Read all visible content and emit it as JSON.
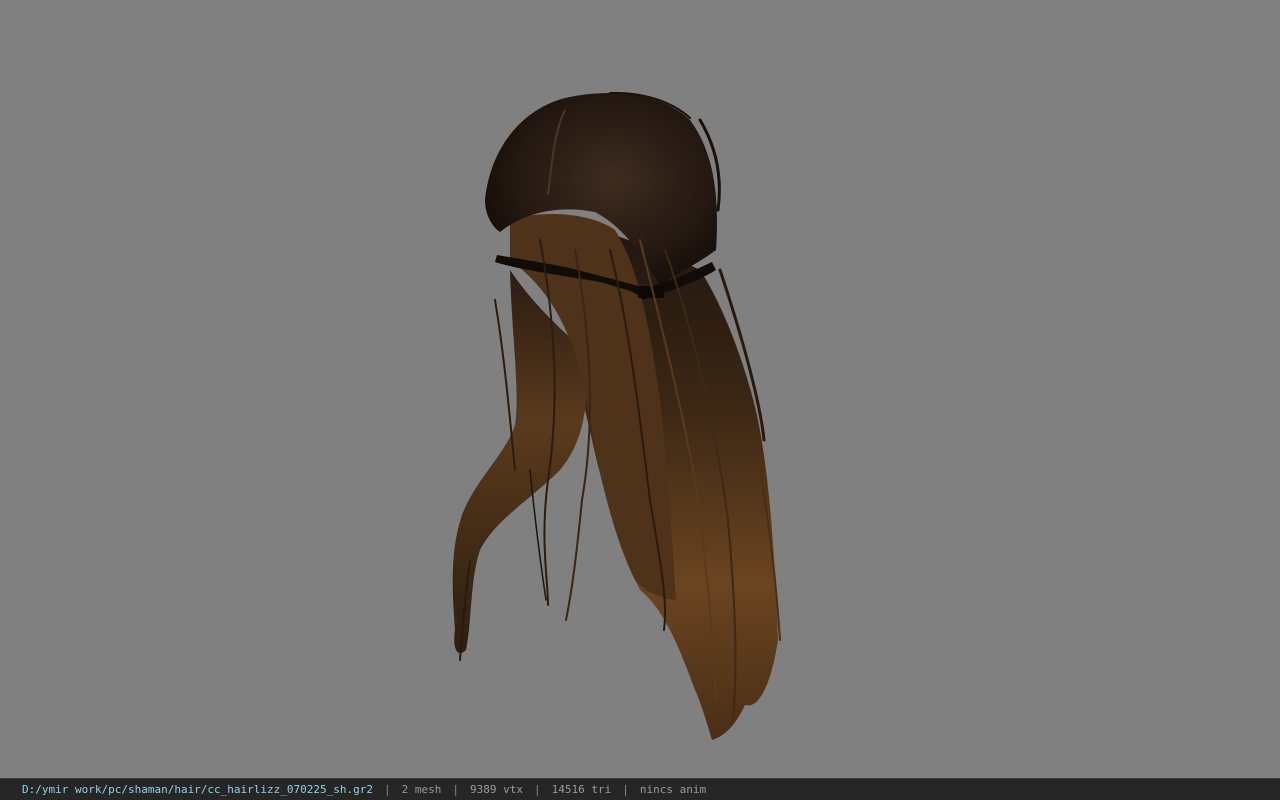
{
  "viewport": {
    "background_color": "#808080",
    "model": "hair-mesh"
  },
  "statusbar": {
    "file_path": "D:/ymir work/pc/shaman/hair/cc_hairlizz_070225_sh.gr2",
    "separator": "|",
    "mesh_count": "2 mesh",
    "vertex_count": "9389 vtx",
    "triangle_count": "14516 tri",
    "anim_status": "nincs anim",
    "path_color": "#8fd0e8"
  }
}
